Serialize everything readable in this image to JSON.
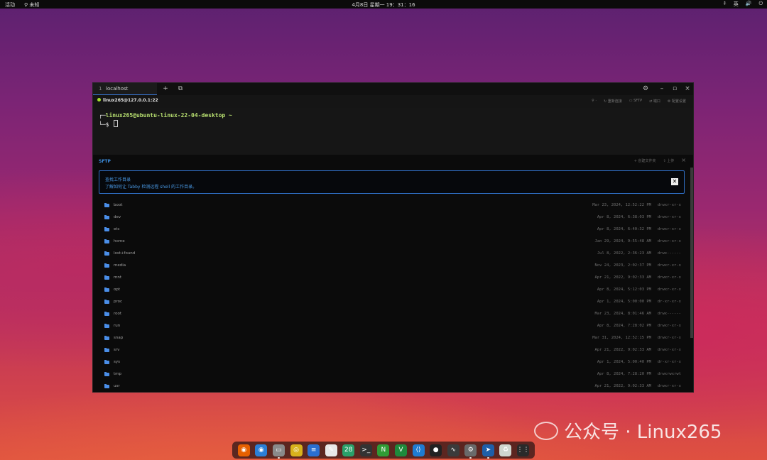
{
  "topbar": {
    "activities": "活动",
    "app": "未知",
    "clock": "4月8日 星期一  19：31：16",
    "tray": [
      "⍏",
      "英",
      "🔊",
      "⏻"
    ]
  },
  "window": {
    "tab": {
      "index": "1",
      "label": "localhost"
    },
    "new_tab_icon": "+",
    "connection": "linux265@127.0.0.1:22",
    "header_buttons": [
      "重新连接",
      "SFTP",
      "端口",
      "配置设置"
    ],
    "terminal": {
      "line1_prefix": "┌─",
      "line1": "linux265@ubuntu-linux-22-04-desktop ~",
      "line2": "└─$ "
    },
    "sftp": {
      "title": "SFTP",
      "buttons": [
        "+ 创建文件夹",
        "上传"
      ],
      "notice_title": "查找工作目录",
      "notice_text": "了解如何让 Tabby 检测远程 shell 的工作目录。",
      "files": [
        {
          "name": "boot",
          "date": "Mar 23, 2024, 12:52:22 PM",
          "perm": "drwxr-xr-x"
        },
        {
          "name": "dev",
          "date": "Apr 8, 2024, 6:38:03 PM",
          "perm": "drwxr-xr-x"
        },
        {
          "name": "etc",
          "date": "Apr 8, 2024, 6:40:32 PM",
          "perm": "drwxr-xr-x"
        },
        {
          "name": "home",
          "date": "Jan 29, 2024, 9:55:48 AM",
          "perm": "drwxr-xr-x"
        },
        {
          "name": "lost+found",
          "date": "Jul 8, 2022, 2:36:23 AM",
          "perm": "drwx------"
        },
        {
          "name": "media",
          "date": "Nov 24, 2023, 2:02:37 PM",
          "perm": "drwxr-xr-x"
        },
        {
          "name": "mnt",
          "date": "Apr 21, 2022, 9:02:33 AM",
          "perm": "drwxr-xr-x"
        },
        {
          "name": "opt",
          "date": "Apr 8, 2024, 5:12:03 PM",
          "perm": "drwxr-xr-x"
        },
        {
          "name": "proc",
          "date": "Apr 1, 2024, 5:00:00 PM",
          "perm": "dr-xr-xr-x"
        },
        {
          "name": "root",
          "date": "Mar 23, 2024, 8:01:46 AM",
          "perm": "drwx------"
        },
        {
          "name": "run",
          "date": "Apr 8, 2024, 7:28:02 PM",
          "perm": "drwxr-xr-x"
        },
        {
          "name": "snap",
          "date": "Mar 31, 2024, 12:52:15 PM",
          "perm": "drwxr-xr-x"
        },
        {
          "name": "srv",
          "date": "Apr 21, 2022, 9:02:33 AM",
          "perm": "drwxr-xr-x"
        },
        {
          "name": "sys",
          "date": "Apr 1, 2024, 5:00:40 PM",
          "perm": "dr-xr-xr-x"
        },
        {
          "name": "tmp",
          "date": "Apr 8, 2024, 7:28:20 PM",
          "perm": "drwxrwxrwt"
        },
        {
          "name": "usr",
          "date": "Apr 21, 2022, 9:02:33 AM",
          "perm": "drwxr-xr-x"
        }
      ]
    }
  },
  "watermark": "公众号 · Linux265",
  "dock": [
    {
      "name": "firefox-icon",
      "glyph": "◉",
      "color": "#e66000",
      "active": false
    },
    {
      "name": "thunderbird-icon",
      "glyph": "◉",
      "color": "#2b7fd6",
      "active": false
    },
    {
      "name": "files-icon",
      "glyph": "▭",
      "color": "#8a8a8a",
      "active": true
    },
    {
      "name": "rhythmbox-icon",
      "glyph": "◎",
      "color": "#d8b21c",
      "active": false
    },
    {
      "name": "writer-icon",
      "glyph": "≡",
      "color": "#2a6fd1",
      "active": false
    },
    {
      "name": "text-editor-icon",
      "glyph": "✎",
      "color": "#e8e8e8",
      "active": false
    },
    {
      "name": "calendar-icon",
      "glyph": "28",
      "color": "#2aa06a",
      "active": false
    },
    {
      "name": "terminal-icon",
      "glyph": ">_",
      "color": "#333333",
      "active": false
    },
    {
      "name": "nvidia-icon",
      "glyph": "N",
      "color": "#2f9c35",
      "active": false
    },
    {
      "name": "vim-icon",
      "glyph": "V",
      "color": "#1e8a3c",
      "active": false
    },
    {
      "name": "vscode-icon",
      "glyph": "⟨⟩",
      "color": "#1f7bd1",
      "active": false
    },
    {
      "name": "qq-icon",
      "glyph": "●",
      "color": "#222222",
      "active": false
    },
    {
      "name": "system-monitor-icon",
      "glyph": "∿",
      "color": "#3b3b3b",
      "active": false
    },
    {
      "name": "settings-icon",
      "glyph": "⚙",
      "color": "#6a6a6a",
      "active": true
    },
    {
      "name": "tabby-icon",
      "glyph": "➤",
      "color": "#1f5fa8",
      "active": true
    },
    {
      "name": "trash-icon",
      "glyph": "♻",
      "color": "#cfd6cf",
      "active": false
    },
    {
      "name": "app-grid-icon",
      "glyph": "⋮⋮",
      "color": "#2a2a2a",
      "active": false
    }
  ]
}
